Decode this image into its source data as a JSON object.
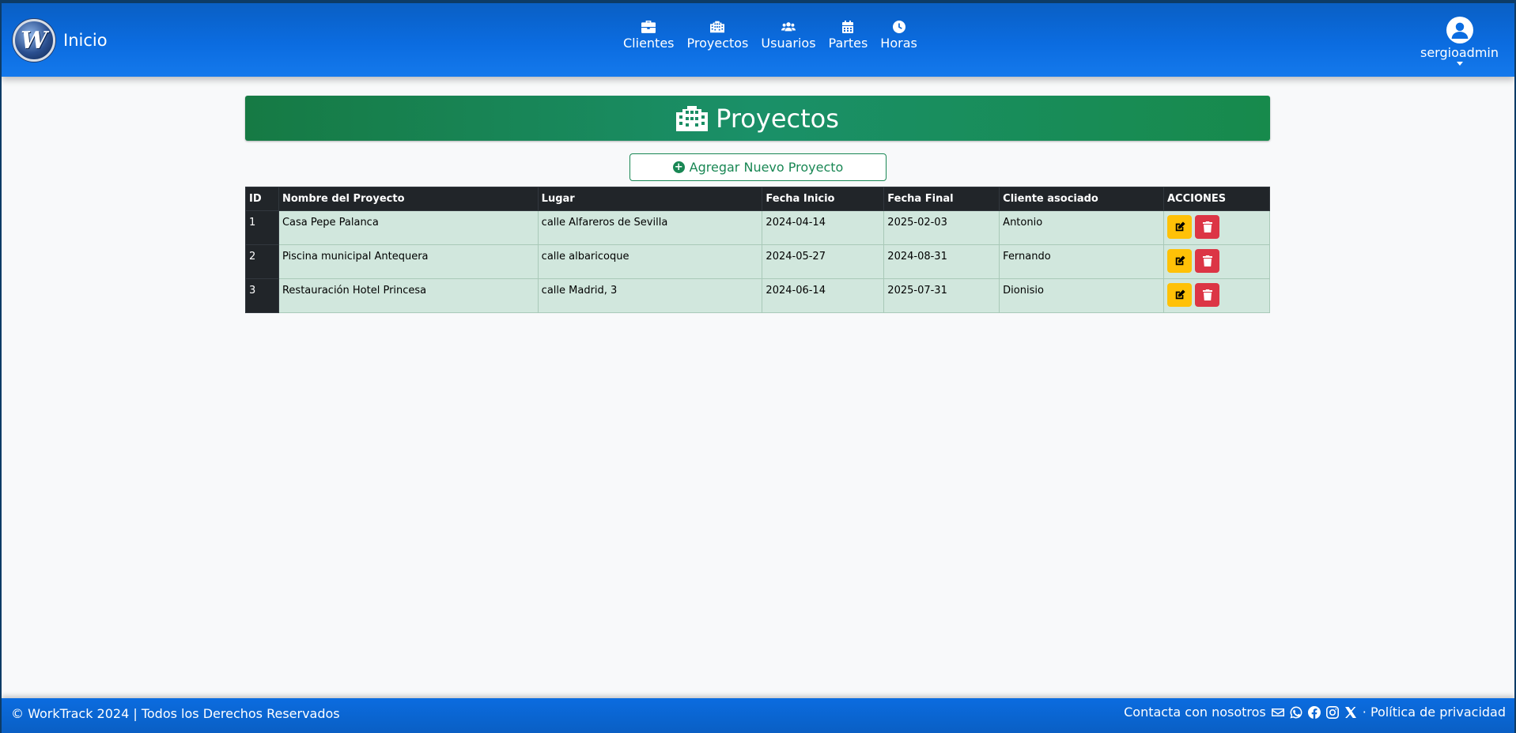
{
  "header": {
    "brand_title": "Inicio",
    "logo_letter": "W",
    "nav": [
      {
        "label": "Clientes",
        "icon": "briefcase-icon"
      },
      {
        "label": "Proyectos",
        "icon": "building-icon"
      },
      {
        "label": "Usuarios",
        "icon": "users-icon"
      },
      {
        "label": "Partes",
        "icon": "calendar-icon"
      },
      {
        "label": "Horas",
        "icon": "clock-icon"
      }
    ],
    "user": {
      "name": "sergioadmin",
      "icon": "user-circle-icon"
    }
  },
  "main": {
    "title": "Proyectos",
    "title_icon": "building-icon",
    "add_button": "Agregar Nuevo Proyecto",
    "table": {
      "headers": [
        "ID",
        "Nombre del Proyecto",
        "Lugar",
        "Fecha Inicio",
        "Fecha Final",
        "Cliente asociado",
        "ACCIONES"
      ],
      "rows": [
        {
          "id": "1",
          "nombre": "Casa Pepe Palanca",
          "lugar": "calle Alfareros de Sevilla",
          "inicio": "2024-04-14",
          "final": "2025-02-03",
          "cliente": "Antonio"
        },
        {
          "id": "2",
          "nombre": "Piscina municipal Antequera",
          "lugar": "calle albaricoque",
          "inicio": "2024-05-27",
          "final": "2024-08-31",
          "cliente": "Fernando"
        },
        {
          "id": "3",
          "nombre": "Restauración Hotel Princesa",
          "lugar": "calle Madrid, 3",
          "inicio": "2024-06-14",
          "final": "2025-07-31",
          "cliente": "Dionisio"
        }
      ]
    }
  },
  "footer": {
    "copyright": "© WorkTrack 2024 | Todos los Derechos Reservados",
    "contact": "Contacta con nosotros",
    "privacy": "· Política de privacidad",
    "social_icons": [
      "envelope-icon",
      "whatsapp-icon",
      "facebook-icon",
      "instagram-icon",
      "x-icon"
    ]
  },
  "colors": {
    "header_blue": "#0b6ce0",
    "banner_green": "#198754",
    "row_green": "#d1e7dd",
    "table_dark": "#212529",
    "edit_yellow": "#ffc107",
    "delete_red": "#dc3545"
  }
}
